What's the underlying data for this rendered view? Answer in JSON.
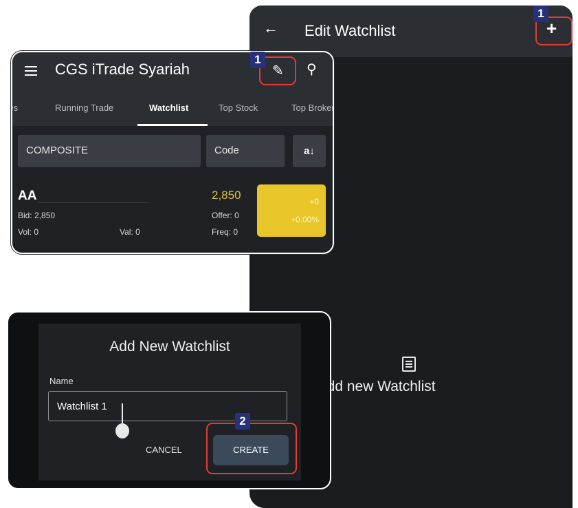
{
  "edit_watchlist": {
    "back_icon": "arrow-left-icon",
    "title": "Edit Watchlist",
    "add_icon": "plus-icon",
    "add_label": "+",
    "empty_icon": "list-icon",
    "empty_message": "Press + to add new Watchlist"
  },
  "trade_app": {
    "menu_icon": "hamburger-icon",
    "title": "CGS iTrade Syariah",
    "edit_icon": "pencil-icon",
    "search_icon": "search-icon",
    "tabs": [
      {
        "label": "Prices"
      },
      {
        "label": "Running Trade"
      },
      {
        "label": "Watchlist"
      },
      {
        "label": "Top Stock"
      },
      {
        "label": "Top Broker"
      }
    ],
    "active_tab": "Watchlist",
    "index_select": "COMPOSITE",
    "sort_select": "Code",
    "sort_icon": "sort-az-icon",
    "sort_label": "a↓",
    "stock": {
      "code": "AA",
      "price": "2,850",
      "bid": "Bid: 2,850",
      "offer": "Offer: 0",
      "vol": "Vol: 0",
      "val": "Val: 0",
      "freq": "Freq: 0",
      "change": "+0",
      "change_pct": "+0.00%"
    }
  },
  "add_dialog": {
    "title": "Add New Watchlist",
    "name_label": "Name",
    "name_value": "Watchlist 1",
    "cancel_label": "CANCEL",
    "create_label": "CREATE"
  },
  "steps": {
    "step1": "1",
    "step2": "2"
  },
  "colors": {
    "highlight": "#e53935",
    "badge": "#27317a",
    "price_up": "#d9c23a",
    "change_box": "#e8c629"
  }
}
